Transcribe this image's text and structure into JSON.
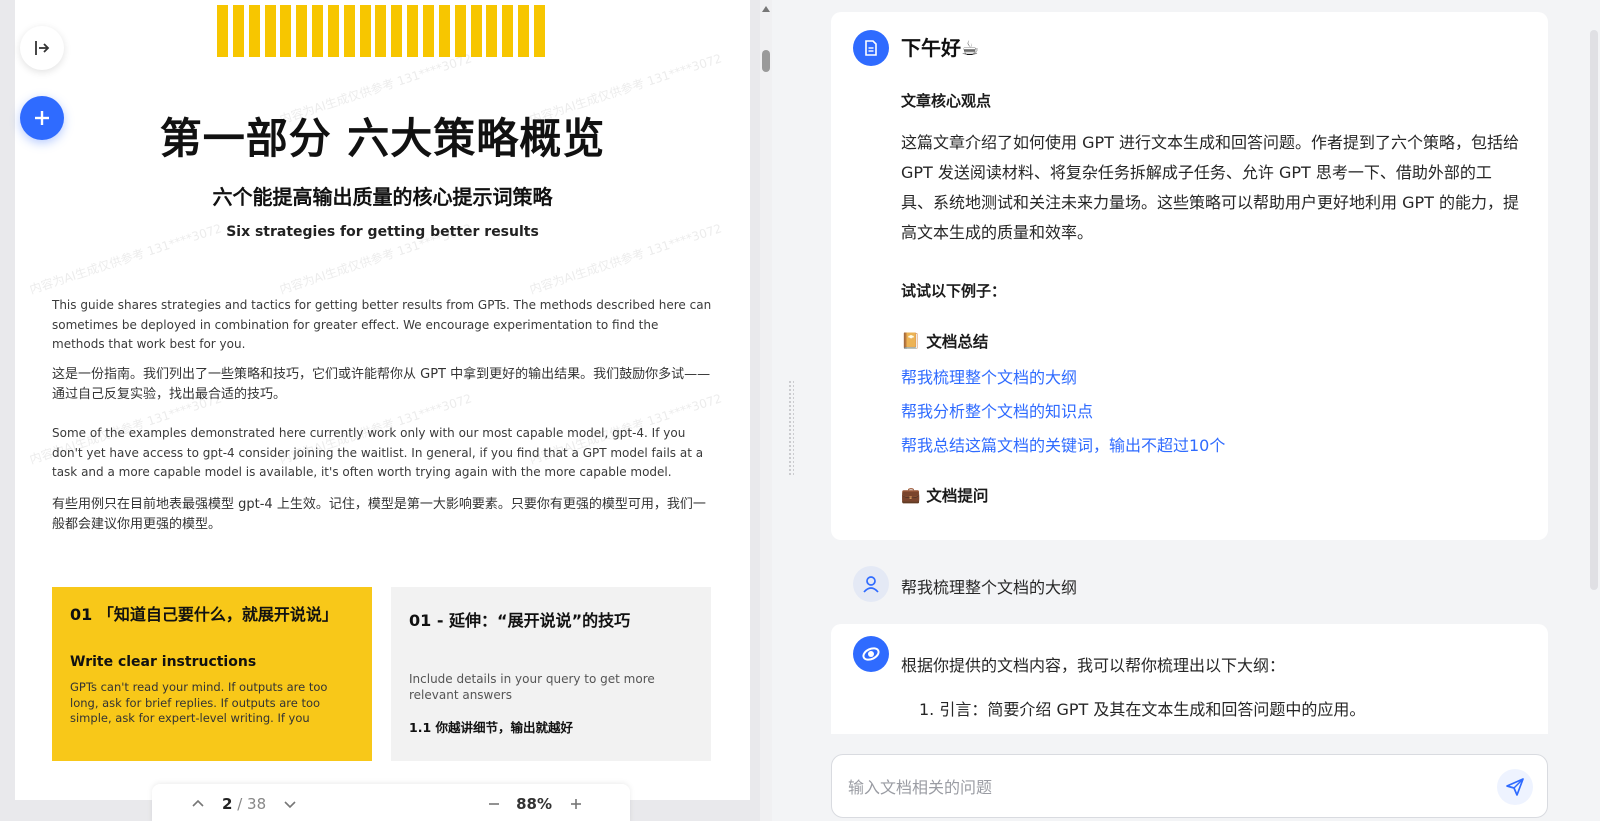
{
  "document": {
    "title": "第一部分 六大策略概览",
    "subtitle": "六个能提高输出质量的核心提示词策略",
    "subtitle_en": "Six strategies for getting better results",
    "para1_en": "This guide shares strategies and tactics for getting better results from GPTs. The methods described here can sometimes be deployed in combination for greater effect. We encourage experimentation to find the methods that work best for you.",
    "para1_zh": "这是一份指南。我们列出了一些策略和技巧，它们或许能帮你从 GPT 中拿到更好的输出结果。我们鼓励你多试——通过自己反复实验，找出最合适的技巧。",
    "para2_en": "Some of the examples demonstrated here currently work only with our most capable model, gpt-4. If you don't yet have access to gpt-4 consider joining the waitlist. In general, if you find that a GPT model fails at a task and a more capable model is available, it's often worth trying again with the more capable model.",
    "para2_zh": "有些用例只在目前地表最强模型 gpt-4 上生效。记住，模型是第一大影响要素。只要你有更强的模型可用，我们一般都会建议你用更强的模型。",
    "card1": {
      "heading": "01 「知道自己要什么，就展开说说」",
      "subheading": "Write clear instructions",
      "body": "GPTs can't read your mind. If outputs are too long, ask for brief replies. If outputs are too simple, ask for expert-level writing. If you"
    },
    "card2": {
      "heading": "01 - 延伸：“展开说说”的技巧",
      "body": "Include details in your query to get more relevant answers",
      "bold": "1.1 你越讲细节，输出就越好"
    },
    "watermark": "内容为AI生成仅供参考 131****3072"
  },
  "pager": {
    "current": "2",
    "separator": " / ",
    "total": "38",
    "zoom": "88%"
  },
  "chat": {
    "greeting": "下午好☕",
    "core_title": "文章核心观点",
    "summary": "这篇文章介绍了如何使用 GPT 进行文本生成和回答问题。作者提到了六个策略，包括给 GPT 发送阅读材料、将复杂任务拆解成子任务、允许 GPT 思考一下、借助外部的工具、系统地测试和关注未来力量场。这些策略可以帮助用户更好地利用 GPT 的能力，提高文本生成的质量和效率。",
    "try_title": "试试以下例子：",
    "section1_icon": "📔",
    "section1_title": "文档总结",
    "links": [
      "帮我梳理整个文档的大纲",
      "帮我分析整个文档的知识点",
      "帮我总结这篇文档的关键词，输出不超过10个"
    ],
    "section2_icon": "💼",
    "section2_title": "文档提问",
    "user_message": "帮我梳理整个文档的大纲",
    "answer_intro": "根据你提供的文档内容，我可以帮你梳理出以下大纲：",
    "answer_item1": "1. 引言：简要介绍 GPT 及其在文本生成和回答问题中的应用。",
    "input_placeholder": "输入文档相关的问题"
  },
  "colors": {
    "accent": "#2f6bff",
    "doc_yellow": "#f8c819",
    "link": "#2f6bff"
  },
  "icons": {
    "exit": "sidebar-exit-icon",
    "add": "plus-icon",
    "doc_avatar": "document-icon",
    "user_avatar": "user-icon",
    "ai_avatar": "ai-logo-icon",
    "send": "send-icon"
  }
}
